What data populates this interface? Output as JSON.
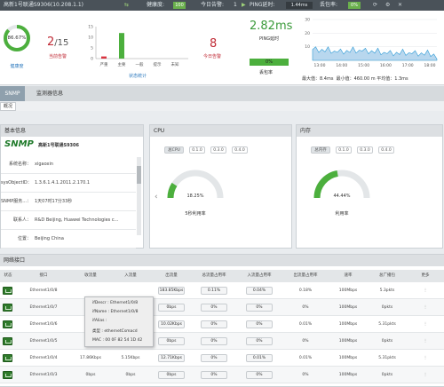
{
  "topbar": {
    "device": "高新1号联通S9306(10.208.1.1)",
    "health_label": "健康度:",
    "health_value": "100",
    "alarms_label": "今日告警:",
    "alarms_value": "1",
    "ping_label": "PING延时:",
    "ping_value": "1.44ms",
    "loss_label": "丢包率:",
    "loss_value": "0%"
  },
  "health": {
    "value": "86.67%",
    "fraction": 0.8667,
    "label": "健康度"
  },
  "alarms": {
    "current_value": "2",
    "current_total": "/15",
    "current_label": "当前告警",
    "axis_ticks": [
      "15",
      "10",
      "5",
      "0"
    ],
    "categories": [
      "严重",
      "主要",
      "一般",
      "提示",
      "未知"
    ],
    "bar_values": [
      1,
      12,
      0,
      0,
      0
    ],
    "bar_colors": [
      "#d9333f",
      "#4caf3d",
      "#4caf3d",
      "#4caf3d",
      "#4caf3d"
    ],
    "stats_label": "状态统计",
    "today_value": "8",
    "today_label": "今日告警"
  },
  "ping": {
    "value": "2.82ms",
    "label": "PING延时",
    "loss_bar": "0%",
    "loss_label": "丢包率",
    "max": "最大值：8.4ms",
    "min": "最小值：460.00 m",
    "avg": "平均值：1.3ms",
    "y_ticks": [
      "30",
      "20",
      "10"
    ],
    "x_ticks": [
      "13:00",
      "14:00",
      "15:00",
      "16:00",
      "17:00",
      "18:00"
    ]
  },
  "chart_data": {
    "type": "area",
    "title": "",
    "x": [
      "13:00",
      "14:00",
      "15:00",
      "16:00",
      "17:00",
      "18:00"
    ],
    "values": [
      5,
      3,
      4,
      2,
      2,
      1
    ],
    "ylim": [
      0,
      30
    ],
    "grid": true
  },
  "tabs": {
    "snmp": "SNMP",
    "monitor": "监测器信息"
  },
  "subtab": "概况",
  "basic": {
    "title": "基本信息",
    "logo": "SNMP",
    "device": "高新1号联通S9306",
    "rows": [
      {
        "k": "系统名称：",
        "v": "xigaoxin"
      },
      {
        "k": "sysObjectID：",
        "v": "1.3.6.1.4.1.2011.2.170.1"
      },
      {
        "k": "SNMP服务...：",
        "v": "1天07时17分33秒"
      },
      {
        "k": "联系人：",
        "v": "R&D Beijing, Huawei Technologies c..."
      },
      {
        "k": "位置：",
        "v": "Beijing China"
      }
    ]
  },
  "cpu": {
    "title": "CPU",
    "pills": [
      "总CPU",
      "0.1.0",
      "0.3.0",
      "0.4.0"
    ],
    "value": "18.25%",
    "fraction": 0.1825,
    "label": "5秒利用率"
  },
  "mem": {
    "title": "内存",
    "pills": [
      "总内存",
      "0.1.0",
      "0.3.0",
      "0.4.0"
    ],
    "value": "44.44%",
    "fraction": 0.4444,
    "label": "利用率"
  },
  "ifaces": {
    "title": "网络接口",
    "headers": [
      "状态",
      "接口",
      "收流量",
      "入流量",
      "出流量",
      "总流量占用率",
      "入流量占用率",
      "出流量占用率",
      "速率",
      "总广播包",
      "更多"
    ],
    "rows": [
      {
        "name": "Ethernet1/0/8",
        "rx": "",
        "inb": "",
        "outb": "183.85Kbps",
        "tot": "0.11%",
        "inp": "0.04%",
        "outp": "0.18%",
        "speed": "100Mbps",
        "bc": "5.3pkts"
      },
      {
        "name": "Ethernet1/0/7",
        "rx": "",
        "inb": "",
        "outb": "0bps",
        "tot": "0%",
        "inp": "0%",
        "outp": "0%",
        "speed": "100Mbps",
        "bc": "0pkts"
      },
      {
        "name": "Ethernet1/0/6",
        "rx": "",
        "inb": "",
        "outb": "10.02Kbps",
        "tot": "0%",
        "inp": "0%",
        "outp": "0.01%",
        "speed": "100Mbps",
        "bc": "5.31pkts"
      },
      {
        "name": "Ethernet1/0/5",
        "rx": "",
        "inb": "",
        "outb": "0bps",
        "tot": "0%",
        "inp": "0%",
        "outp": "0%",
        "speed": "100Mbps",
        "bc": "0pkts"
      },
      {
        "name": "Ethernet1/0/4",
        "rx": "17.86Kbps",
        "inb": "5.15Kbps",
        "outb": "12.71Kbps",
        "tot": "0%",
        "inp": "0.01%",
        "outp": "0.01%",
        "speed": "100Mbps",
        "bc": "5.31pkts"
      },
      {
        "name": "Ethernet1/0/3",
        "rx": "0bps",
        "inb": "0bps",
        "outb": "0bps",
        "tot": "0%",
        "inp": "0%",
        "outp": "0%",
        "speed": "100Mbps",
        "bc": "0pkts"
      }
    ]
  },
  "tooltip": {
    "descr": "ifDescr : Ethernet1/0/8",
    "name": "ifName : Ethernet1/0/8",
    "alias": "ifAlias :",
    "type": "类型 : ethernetCsmacd",
    "mac": "MAC : 00 0F 82 54 1D 42"
  },
  "colors": {
    "green": "#4caf3d",
    "red": "#d9333f",
    "topbar": "#4a5259",
    "accent": "#2e9bd6"
  }
}
